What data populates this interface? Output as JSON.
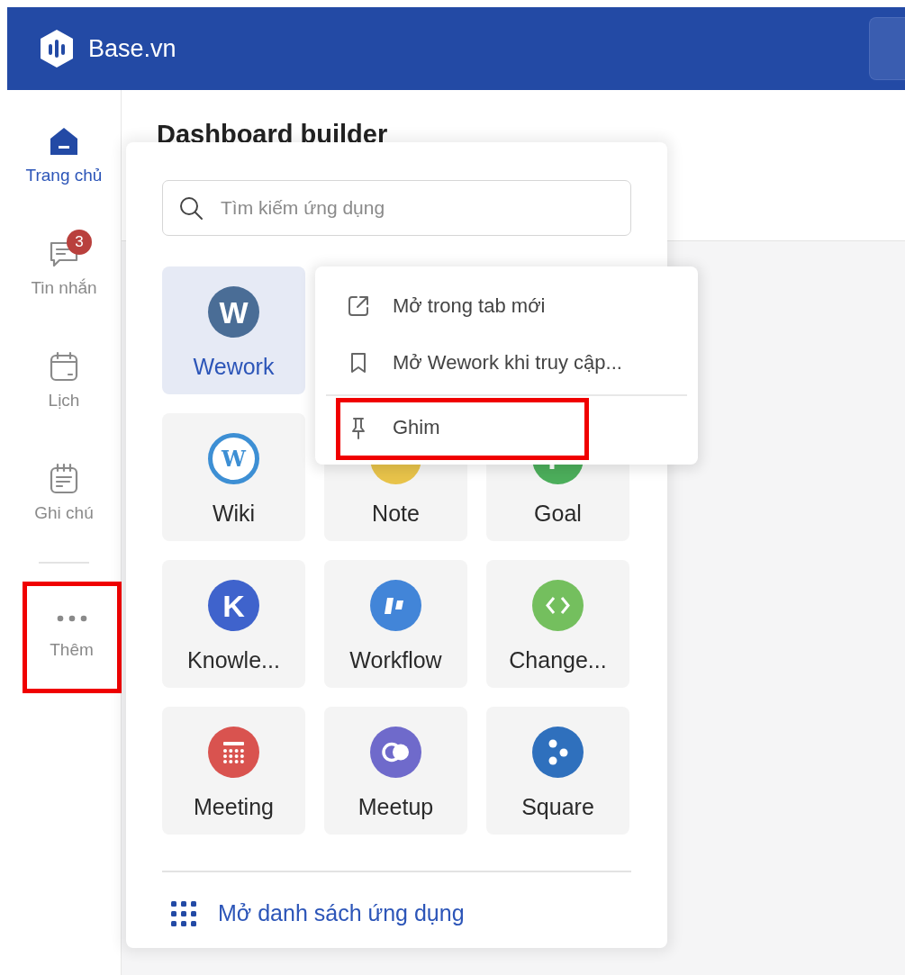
{
  "header": {
    "logo_text": "Base.vn"
  },
  "sidebar": {
    "items": [
      {
        "kind": "home",
        "label": "Trang chủ",
        "selected": true
      },
      {
        "kind": "chat",
        "label": "Tin nhắn",
        "selected": false,
        "badge": "3"
      },
      {
        "kind": "calendar",
        "label": "Lịch",
        "selected": false
      },
      {
        "kind": "note",
        "label": "Ghi chú",
        "selected": false
      }
    ],
    "more": {
      "label": "Thêm",
      "highlighted": true
    }
  },
  "page": {
    "title": "Dashboard builder"
  },
  "app_menu": {
    "search": {
      "placeholder": "Tìm kiếm ứng dụng"
    },
    "apps": [
      {
        "name": "Wework",
        "kind": "letter",
        "glyph": "W",
        "color": "#4a6d96",
        "selected": true
      },
      {
        "name": "Wiki",
        "kind": "ring",
        "glyph": "W",
        "color": "#3d8fd4",
        "selected": false
      },
      {
        "name": "Note",
        "kind": "note",
        "color": "#e8c34a",
        "selected": false
      },
      {
        "name": "Goal",
        "kind": "goal",
        "color": "#4cae5b",
        "selected": false
      },
      {
        "name": "Knowle...",
        "kind": "letter",
        "glyph": "K",
        "color": "#3f63cc",
        "selected": false
      },
      {
        "name": "Workflow",
        "kind": "workflow",
        "color": "#4285d8",
        "selected": false
      },
      {
        "name": "Change...",
        "kind": "code",
        "color": "#74bf5e",
        "selected": false
      },
      {
        "name": "Meeting",
        "kind": "meeting",
        "color": "#d9534f",
        "selected": false
      },
      {
        "name": "Meetup",
        "kind": "meetup",
        "color": "#6f6acb",
        "selected": false
      },
      {
        "name": "Square",
        "kind": "square",
        "color": "#2f70bd",
        "selected": false
      }
    ],
    "footer_link": "Mở danh sách ứng dụng"
  },
  "context_menu": {
    "items": [
      {
        "kind": "external",
        "label": "Mở trong tab mới",
        "highlighted": false
      },
      {
        "kind": "bookmark",
        "label": "Mở Wework khi truy cập...",
        "highlighted": false
      },
      {
        "kind": "pin",
        "label": "Ghim",
        "highlighted": true
      }
    ]
  }
}
